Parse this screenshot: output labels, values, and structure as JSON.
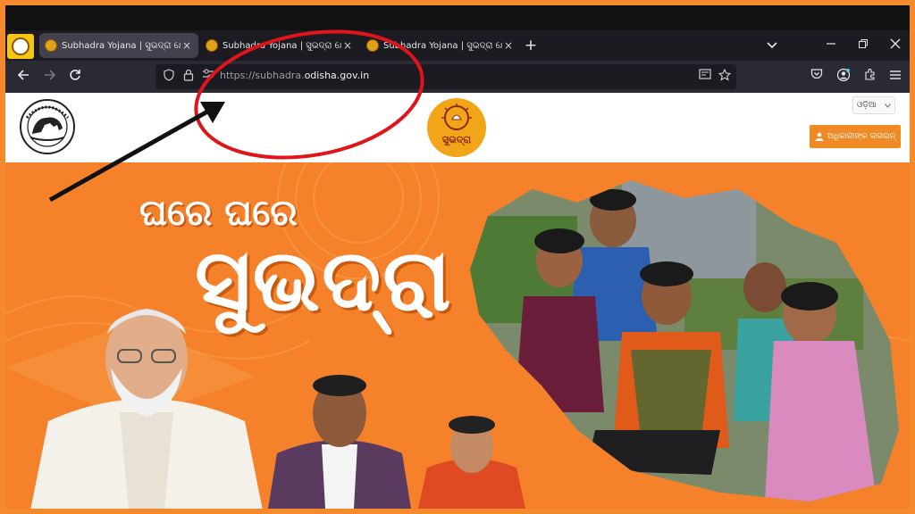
{
  "browser": {
    "tabs": [
      {
        "title": "Subhadra Yojana | ସୁଭଦ୍ରା ଯୋଜନା",
        "active": true
      },
      {
        "title": "Subhadra Yojana | ସୁଭଦ୍ରା ଯୋଜନା",
        "active": false
      },
      {
        "title": "Subhadra Yojana | ସୁଭଦ୍ରା ଯୋଜନା",
        "active": false
      }
    ],
    "close_glyph": "×",
    "new_tab_glyph": "+",
    "url_prefix": "https://subhadra.",
    "url_domain": "odisha.gov.in"
  },
  "site": {
    "language_selected": "ଓଡ଼ିଆ",
    "login_label": "ଅଧିକାରୀଙ୍କ ଲଗଇନ୍",
    "logo_text": "ସୁଭଦ୍ରା"
  },
  "banner": {
    "tagline": "ଘରେ ଘରେ",
    "title": "ସୁଭଦ୍ରା"
  },
  "colors": {
    "accent": "#f5822a",
    "annotation_red": "#e0141b"
  },
  "icons": [
    "emblem-icon",
    "subhadra-logo-icon",
    "user-icon",
    "shield-icon",
    "lock-icon",
    "reader-icon",
    "star-icon",
    "pocket-icon",
    "account-icon",
    "extensions-icon",
    "menu-icon"
  ]
}
